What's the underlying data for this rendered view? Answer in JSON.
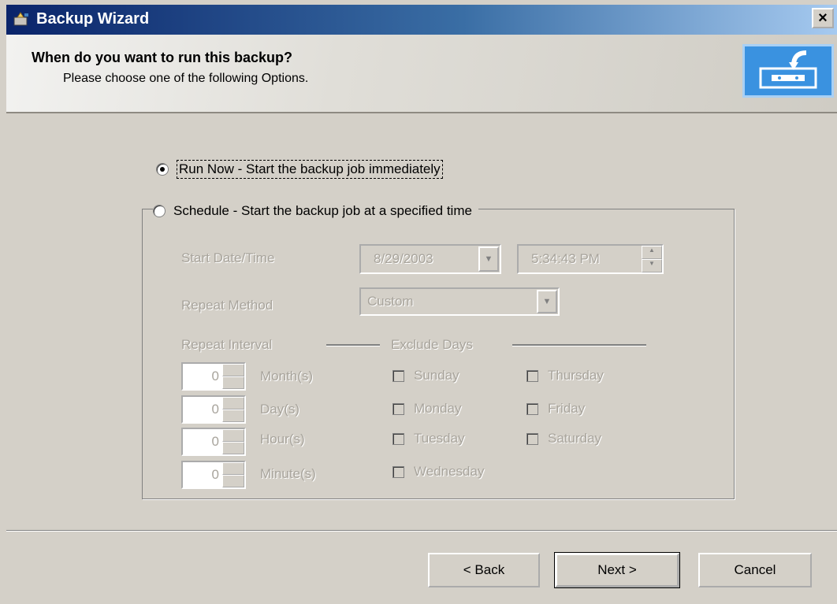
{
  "window": {
    "title": "Backup Wizard",
    "close_label": "×"
  },
  "header": {
    "title": "When do you want to run this backup?",
    "subtitle": "Please choose one of the following Options."
  },
  "options": {
    "run_now_label": "Run Now - Start the backup job immediately",
    "run_now_checked": true,
    "schedule_label": "Schedule - Start the backup job at a specified time",
    "schedule_checked": false
  },
  "schedule": {
    "start_label": "Start Date/Time",
    "start_date": "8/29/2003",
    "start_time": "5:34:43 PM",
    "repeat_method_label": "Repeat Method",
    "repeat_method_value": "Custom",
    "repeat_interval_label": "Repeat Interval",
    "exclude_days_label": "Exclude Days",
    "intervals": [
      {
        "value": "0",
        "unit": "Month(s)"
      },
      {
        "value": "0",
        "unit": "Day(s)"
      },
      {
        "value": "0",
        "unit": "Hour(s)"
      },
      {
        "value": "0",
        "unit": "Minute(s)"
      }
    ],
    "days": [
      "Sunday",
      "Monday",
      "Tuesday",
      "Wednesday",
      "Thursday",
      "Friday",
      "Saturday"
    ]
  },
  "buttons": {
    "back": "< Back",
    "next": "Next >",
    "cancel": "Cancel"
  }
}
